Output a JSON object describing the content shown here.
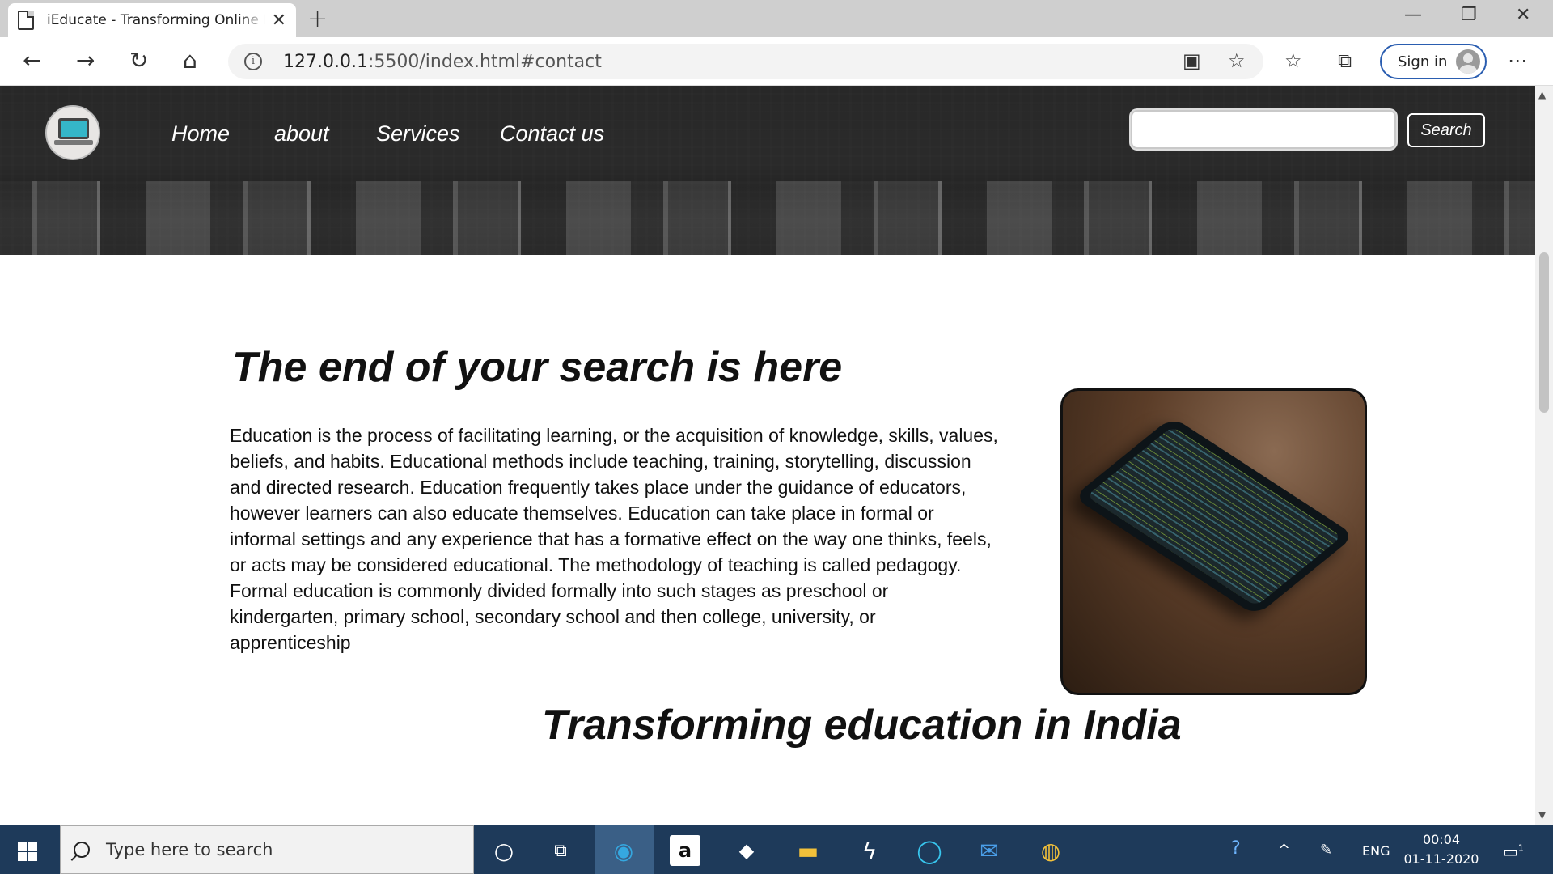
{
  "browser": {
    "tab_title": "iEducate - Transforming Online E",
    "new_tab_icon": "+",
    "url_host": "127.0.0.1",
    "url_rest": ":5500/index.html#contact",
    "sign_in_label": "Sign in"
  },
  "site": {
    "nav": {
      "home": "Home",
      "about": "about",
      "services": "Services",
      "contact": "Contact us"
    },
    "search": {
      "placeholder": "",
      "button_label": "Search"
    },
    "section1": {
      "heading": "The end of your search is here",
      "paragraph": "Education is the process of facilitating learning, or the acquisition of knowledge, skills, values, beliefs, and habits. Educational methods include teaching, training, storytelling, discussion and directed research. Education frequently takes place under the guidance of educators, however learners can also educate themselves. Education can take place in formal or informal settings and any experience that has a formative effect on the way one thinks, feels, or acts may be considered educational. The methodology of teaching is called pedagogy. Formal education is commonly divided formally into such stages as preschool or kindergarten, primary school, secondary school and then college, university, or apprenticeship"
    },
    "section2": {
      "heading": "Transforming education in India"
    }
  },
  "taskbar": {
    "search_placeholder": "Type here to search",
    "language": "ENG",
    "time": "00:04",
    "date": "01-11-2020",
    "notification_count": "1"
  },
  "colors": {
    "taskbar": "#1e3a5a",
    "signin_border": "#2a5db0",
    "navbar_overlay": "#232323"
  }
}
